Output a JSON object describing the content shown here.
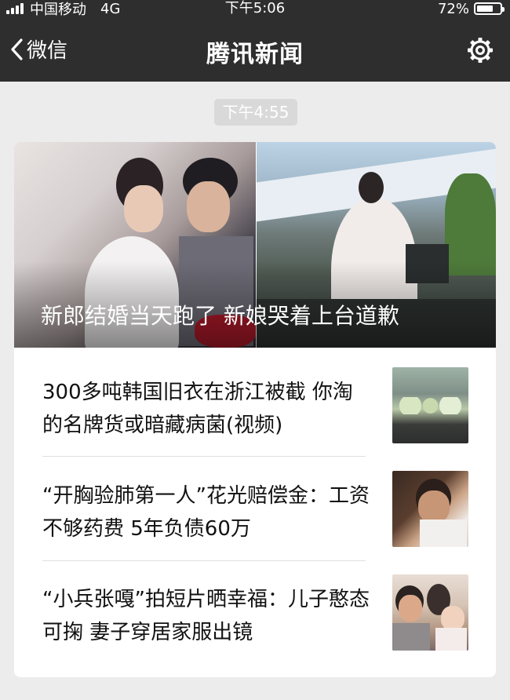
{
  "status_bar": {
    "carrier": "中国移动",
    "network": "4G",
    "time": "下午5:06",
    "battery_text": "72%",
    "battery_level": 0.72
  },
  "nav": {
    "back_label": "微信",
    "title": "腾讯新闻",
    "settings_icon": "gear-icon"
  },
  "message": {
    "timestamp": "下午4:55",
    "hero_title": "新郎结婚当天跑了 新娘哭着上台道歉",
    "items": [
      {
        "text": "300多吨韩国旧衣在浙江被截 你淘的名牌货或暗藏病菌(视频)"
      },
      {
        "text": "“开胸验肺第一人”花光赔偿金：工资不够药费 5年负债60万"
      },
      {
        "text": "“小兵张嘎”拍短片晒幸福：儿子憨态可掬 妻子穿居家服出镜"
      }
    ]
  }
}
